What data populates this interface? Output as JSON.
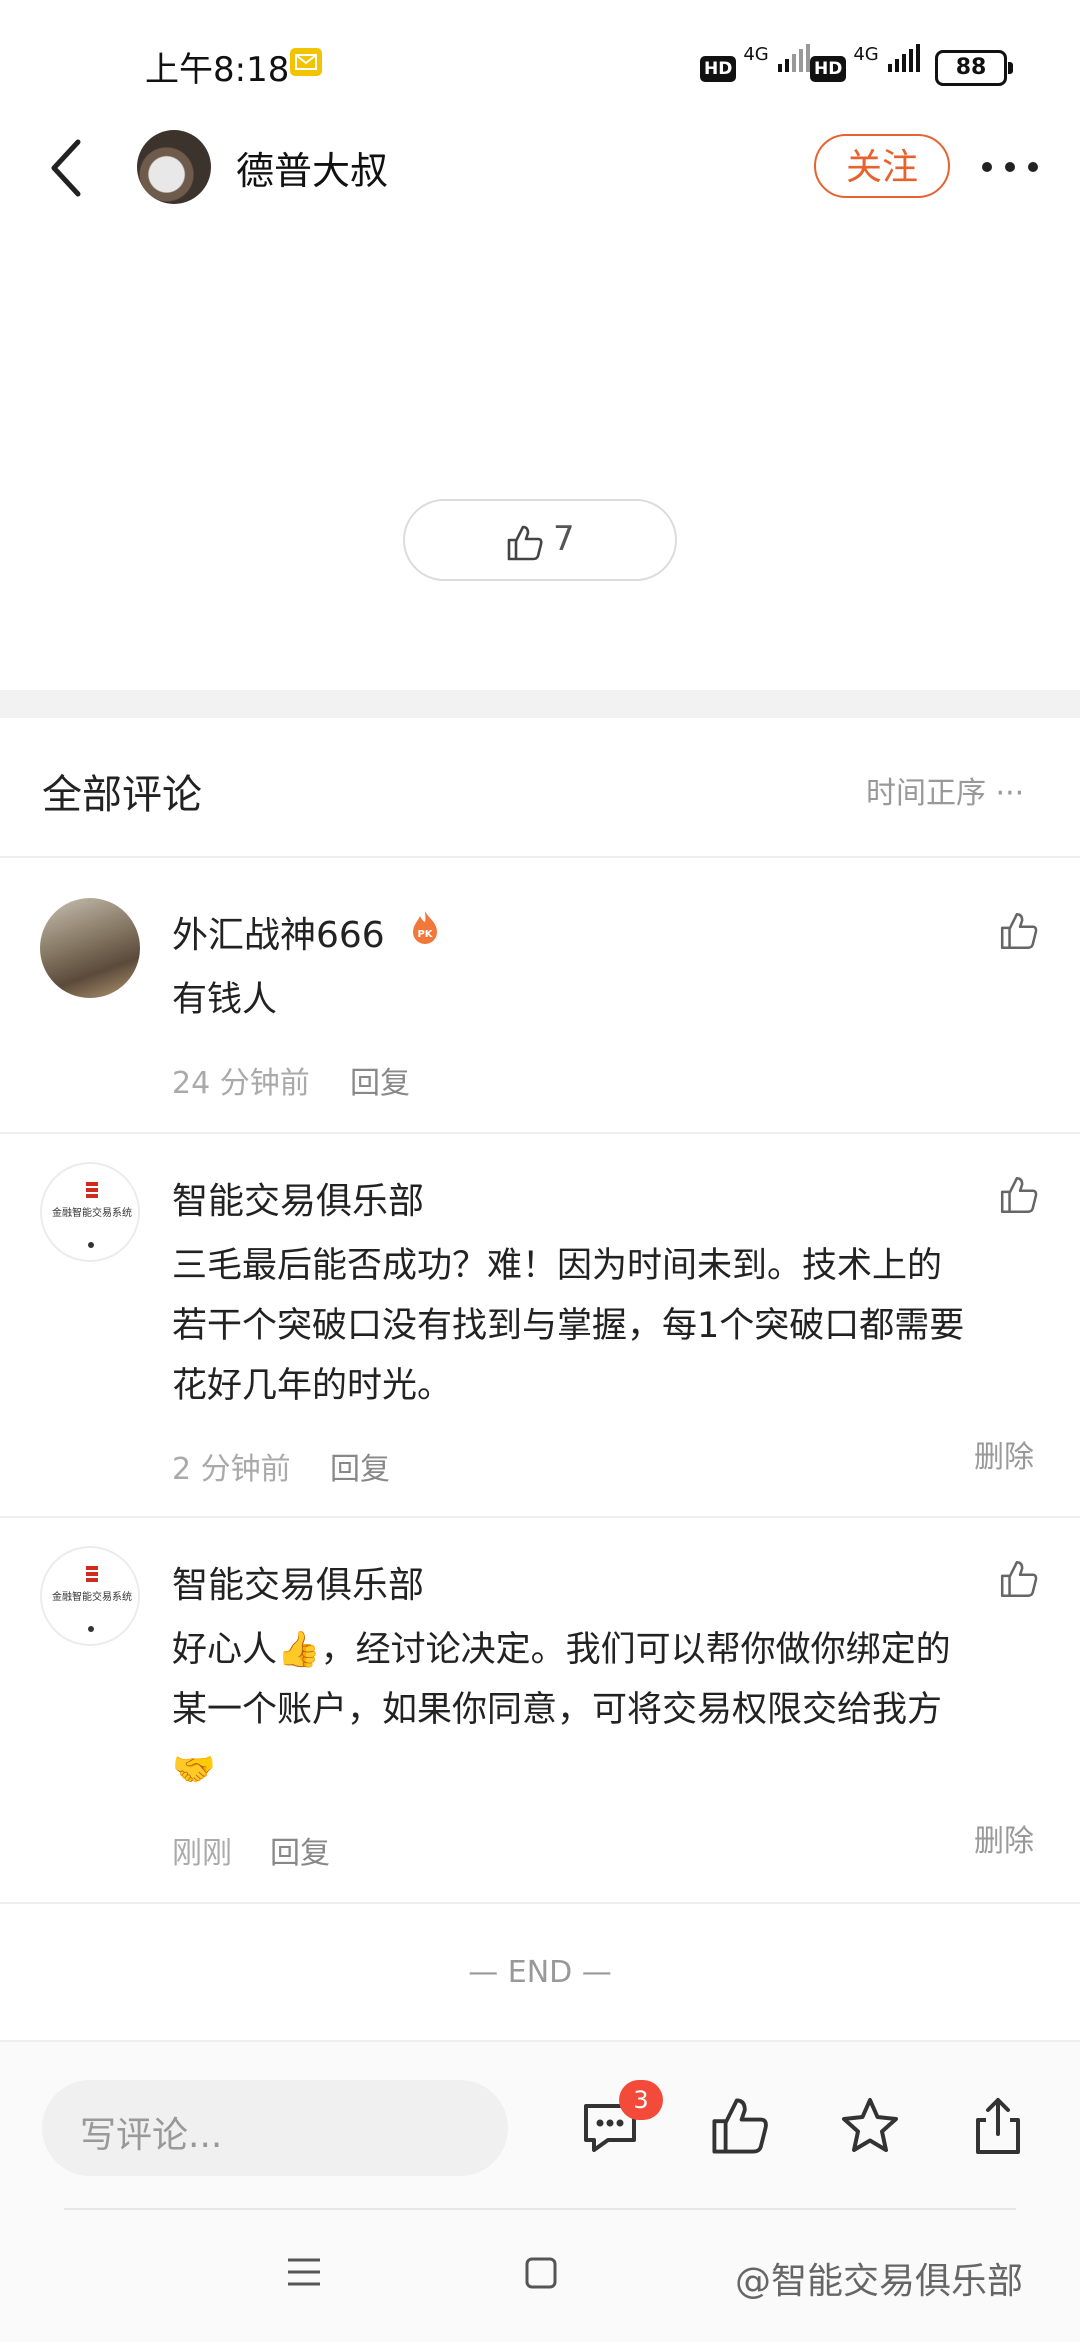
{
  "status_bar": {
    "time": "上午8:18",
    "sim1_hd": "HD",
    "sim1_net": "4G",
    "sim2_hd": "HD",
    "sim2_net": "4G",
    "battery": "88"
  },
  "header": {
    "author_name": "德普大叔",
    "follow_label": "关注"
  },
  "post": {
    "like_count": "7"
  },
  "comments_section": {
    "title": "全部评论",
    "sort_label": "时间正序 ···"
  },
  "comments": [
    {
      "name": "外汇战神666",
      "text_lines": [
        "有钱人"
      ],
      "time": "24 分钟前",
      "reply_label": "回复",
      "delete_label": ""
    },
    {
      "name": "智能交易俱乐部",
      "avatar_text": "金融智能交易系统",
      "text_lines": [
        "三毛最后能否成功？难！因为时间未到。技术上的",
        "若干个突破口没有找到与掌握，每1个突破口都需要",
        "花好几年的时光。"
      ],
      "time": "2 分钟前",
      "reply_label": "回复",
      "delete_label": "删除"
    },
    {
      "name": "智能交易俱乐部",
      "avatar_text": "金融智能交易系统",
      "text_lines": [
        "好心人👍，经讨论决定。我们可以帮你做你绑定的",
        "某一个账户，如果你同意，可将交易权限交给我方",
        "🤝"
      ],
      "time": "刚刚",
      "reply_label": "回复",
      "delete_label": "删除"
    }
  ],
  "end_marker": "— END —",
  "bottom_bar": {
    "input_placeholder": "写评论...",
    "comment_badge": "3"
  },
  "watermark": "@智能交易俱乐部",
  "colors": {
    "accent": "#e8622d",
    "badge": "#f34a3a"
  }
}
